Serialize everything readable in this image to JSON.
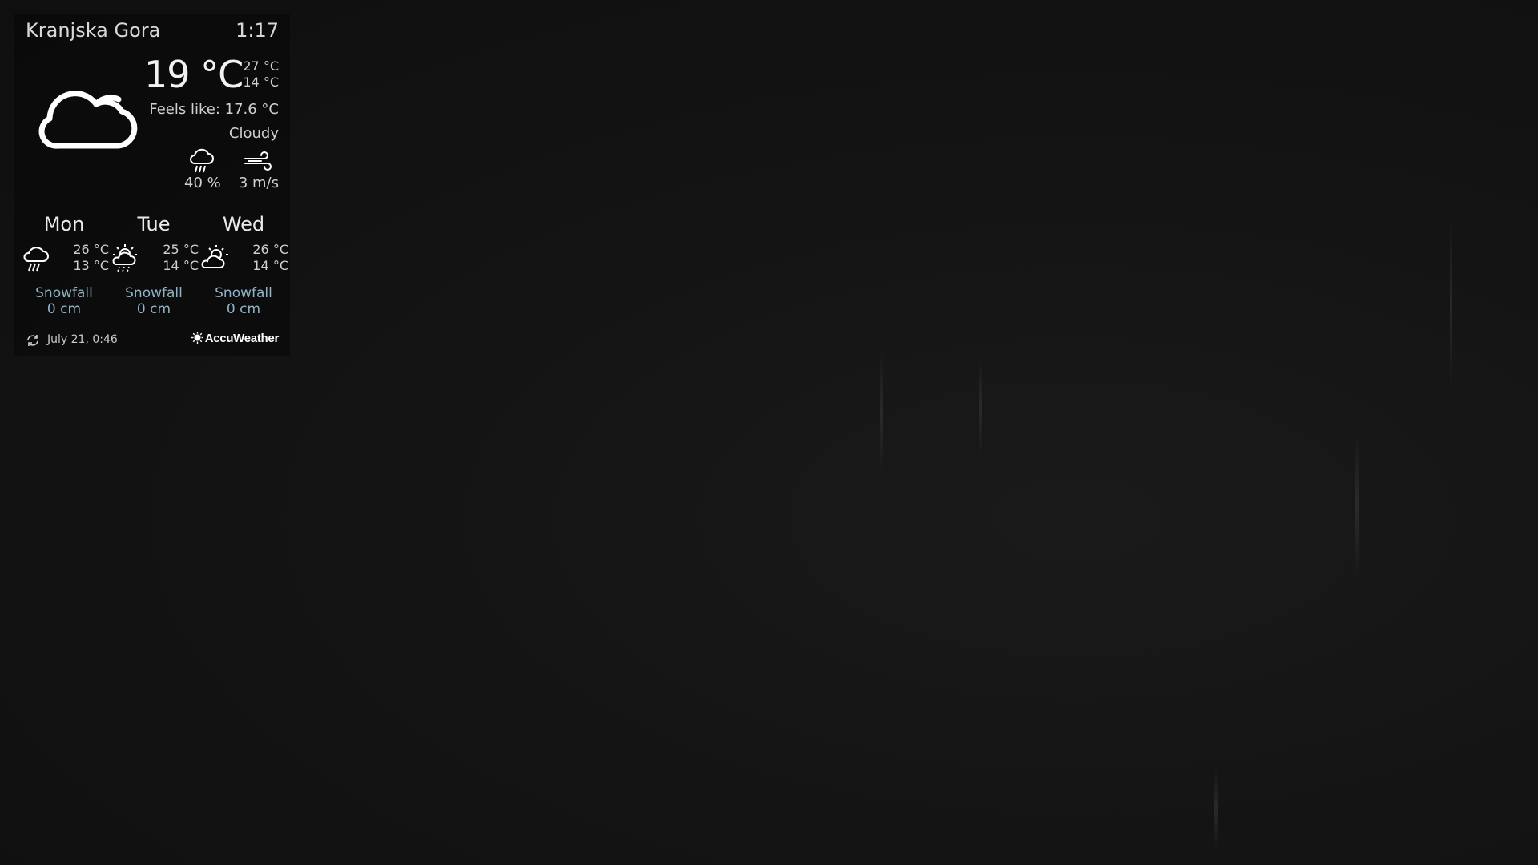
{
  "location": "Kranjska Gora",
  "time": "1:17",
  "current": {
    "temperature": "19 °C",
    "high": "27 °C",
    "low": "14 °C",
    "feels_like": "Feels like: 17.6 °C",
    "condition": "Cloudy",
    "icon": "cloud-icon",
    "precipitation": "40 %",
    "wind": "3 m/s"
  },
  "forecast": [
    {
      "day": "Mon",
      "high": "26 °C",
      "low": "13 °C",
      "icon": "rain-cloud-icon",
      "snow_label": "Snowfall",
      "snow_value": "0 cm"
    },
    {
      "day": "Tue",
      "high": "25 °C",
      "low": "14 °C",
      "icon": "sun-rain-icon",
      "snow_label": "Snowfall",
      "snow_value": "0 cm"
    },
    {
      "day": "Wed",
      "high": "26 °C",
      "low": "14 °C",
      "icon": "sun-cloud-icon",
      "snow_label": "Snowfall",
      "snow_value": "0 cm"
    }
  ],
  "footer": {
    "updated": "July 21, 0:46",
    "brand": "AccuWeather"
  },
  "colors": {
    "snow_text": "#8fb4c8",
    "background": "#121212"
  }
}
